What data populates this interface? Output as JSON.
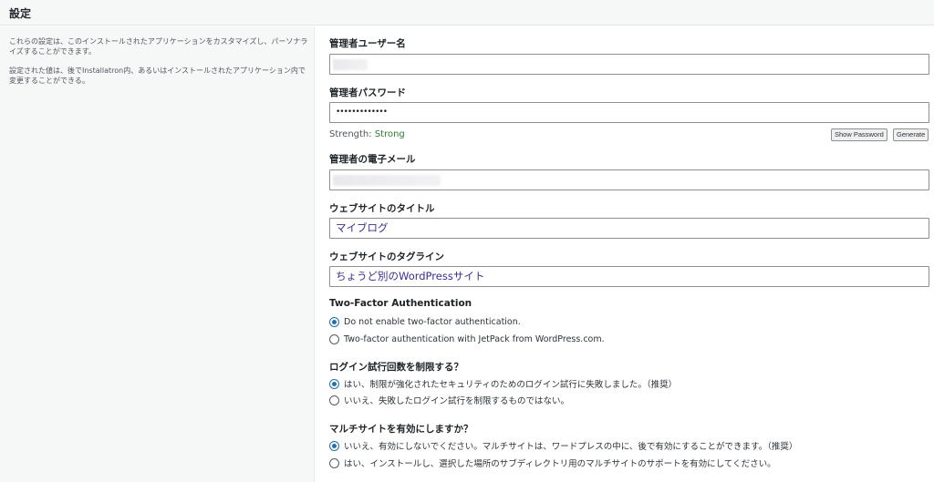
{
  "header": {
    "title": "設定"
  },
  "sidebar": {
    "description1": "これらの設定は、このインストールされたアプリケーションをカスタマイズし、パーソナライズすることができます。",
    "description2": "設定された値は、後でInstallatron内、あるいはインストールされたアプリケーション内で変更することができる。"
  },
  "form": {
    "admin_user": {
      "label": "管理者ユーザー名",
      "value": ""
    },
    "admin_password": {
      "label": "管理者パスワード",
      "value": "•••••••••••••"
    },
    "strength": {
      "prefix": "Strength: ",
      "value": "Strong",
      "color": "#2e7d32"
    },
    "buttons": {
      "show_password": "Show Password",
      "generate": "Generate"
    },
    "admin_email": {
      "label": "管理者の電子メール",
      "value": ""
    },
    "site_title": {
      "label": "ウェブサイトのタイトル",
      "value": "マイブログ"
    },
    "site_tagline": {
      "label": "ウェブサイトのタグライン",
      "value": "ちょうど別のWordPressサイト"
    },
    "two_factor": {
      "label": "Two-Factor Authentication",
      "options": [
        {
          "text": "Do not enable two-factor authentication.",
          "checked": true
        },
        {
          "text": "Two-factor authentication with JetPack from WordPress.com.",
          "checked": false
        }
      ]
    },
    "limit_login": {
      "label": "ログイン試行回数を制限する？",
      "options": [
        {
          "text": "はい、制限が強化されたセキュリティのためのログイン試行に失敗しました。（推奨）",
          "checked": true
        },
        {
          "text": "いいえ、失敗したログイン試行を制限するものではない。",
          "checked": false
        }
      ]
    },
    "multisite": {
      "label": "マルチサイトを有効にしますか？",
      "options": [
        {
          "text": "いいえ、有効にしないでください。マルチサイトは、ワードプレスの中に、後で有効にすることができます。（推奨）",
          "checked": true
        },
        {
          "text": "はい、インストールし、選択した場所のサブディレクトリ用のマルチサイトのサポートを有効にしてください。",
          "checked": false
        }
      ]
    }
  },
  "colors": {
    "accent": "#2271b1",
    "text_value": "#3c2d8c"
  }
}
